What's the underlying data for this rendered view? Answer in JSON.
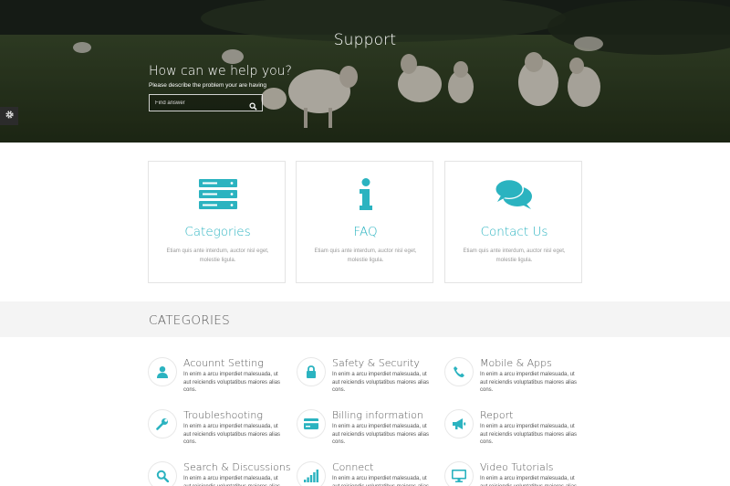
{
  "hero": {
    "title": "Support",
    "help_heading": "How can we help you?",
    "description": "Please describe the problem your are having",
    "search_placeholder": "Find answer",
    "search_icon": "search-icon"
  },
  "colors": {
    "accent": "#2bb3c0",
    "band": "#f4f4f4",
    "settings_tab": "#2b2b2b"
  },
  "features": [
    {
      "title": "Categories",
      "icon": "server-icon",
      "description": "Etiam quis ante interdum, auctor nisl eget, molestie ligula."
    },
    {
      "title": "FAQ",
      "icon": "info-icon",
      "description": "Etiam quis ante interdum, auctor nisl eget, molestie ligula."
    },
    {
      "title": "Contact Us",
      "icon": "chat-bubbles-icon",
      "description": "Etiam quis ante interdum, auctor nisl eget, molestie ligula."
    }
  ],
  "categories": {
    "title": "CATEGORIES",
    "items": [
      {
        "title": "Acounnt Setting",
        "icon": "user-icon",
        "description": "In enim a arcu imperdiet malesuada, ut aut reiciendis voluptatibus maiores alias cons."
      },
      {
        "title": "Safety & Security",
        "icon": "lock-icon",
        "description": "In enim a arcu imperdiet malesuada, ut aut reiciendis voluptatibus maiores alias cons."
      },
      {
        "title": "Mobile & Apps",
        "icon": "phone-icon",
        "description": "In enim a arcu imperdiet malesuada, ut aut reiciendis voluptatibus maiores alias cons."
      },
      {
        "title": "Troubleshooting",
        "icon": "wrench-icon",
        "description": "In enim a arcu imperdiet malesuada, ut aut reiciendis voluptatibus maiores alias cons."
      },
      {
        "title": "Billing information",
        "icon": "credit-card-icon",
        "description": "In enim a arcu imperdiet malesuada, ut aut reiciendis voluptatibus maiores alias cons."
      },
      {
        "title": "Report",
        "icon": "megaphone-icon",
        "description": "In enim a arcu imperdiet malesuada, ut aut reiciendis voluptatibus maiores alias cons."
      },
      {
        "title": "Search & Discussions",
        "icon": "search-icon",
        "description": "In enim a arcu imperdiet malesuada, ut aut reiciendis voluptatibus maiores alias cons."
      },
      {
        "title": "Connect",
        "icon": "signal-bars-icon",
        "description": "In enim a arcu imperdiet malesuada, ut aut reiciendis voluptatibus maiores alias cons."
      },
      {
        "title": "Video Tutorials",
        "icon": "monitor-icon",
        "description": "In enim a arcu imperdiet malesuada, ut aut reiciendis voluptatibus maiores alias cons."
      }
    ]
  },
  "settings": {
    "icon": "gear-icon"
  }
}
